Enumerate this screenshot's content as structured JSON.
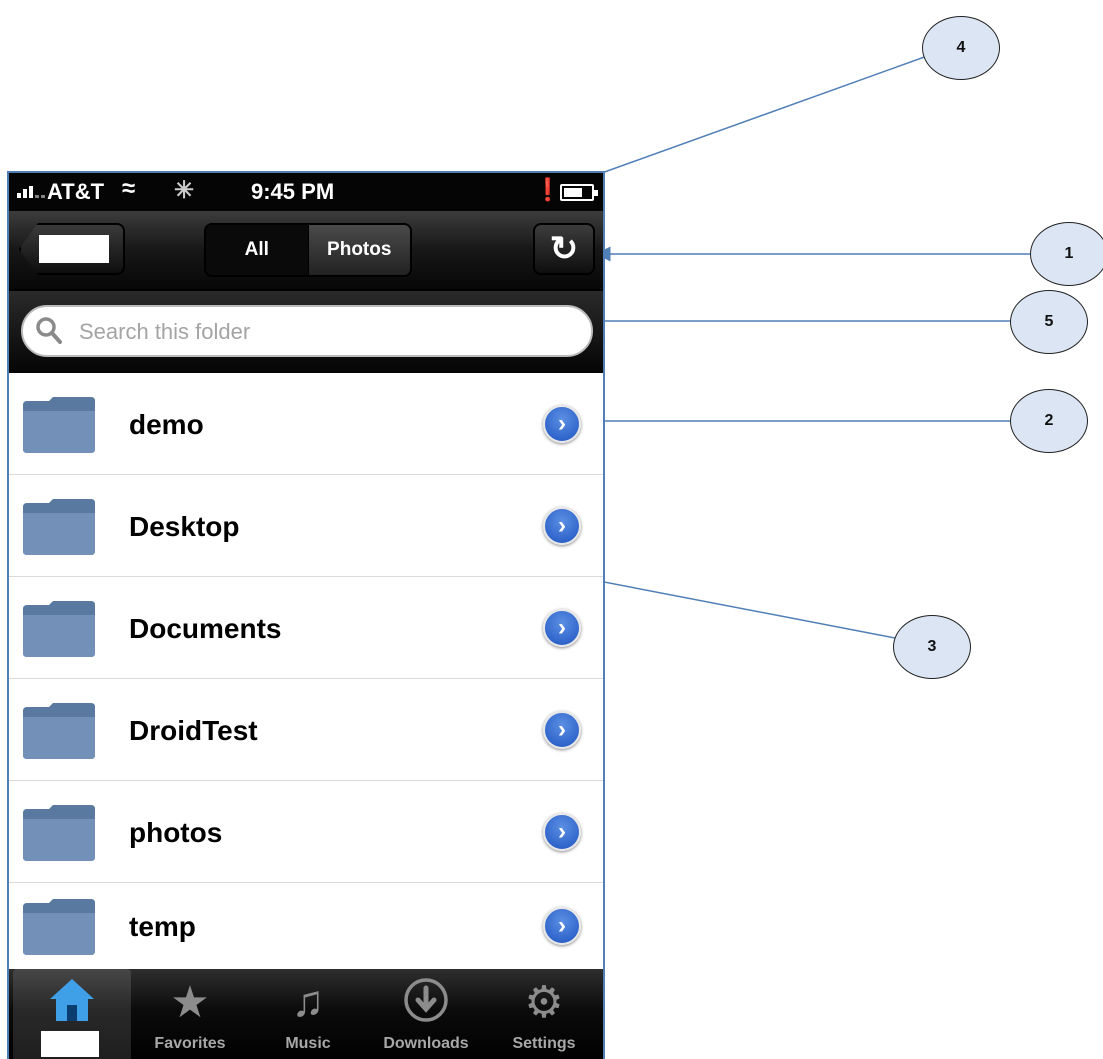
{
  "status_bar": {
    "carrier": "AT&T",
    "time": "9:45 PM"
  },
  "nav_bar": {
    "segments": [
      "All",
      "Photos"
    ],
    "selected_segment": "Photos",
    "refresh_glyph": "↻"
  },
  "search": {
    "placeholder": "Search this folder"
  },
  "folders": [
    {
      "name": "demo"
    },
    {
      "name": "Desktop"
    },
    {
      "name": "Documents"
    },
    {
      "name": "DroidTest"
    },
    {
      "name": "photos"
    },
    {
      "name": "temp"
    }
  ],
  "tab_bar": {
    "tabs": [
      {
        "label": "",
        "icon": "home-icon"
      },
      {
        "label": "Favorites",
        "icon": "star-icon"
      },
      {
        "label": "Music",
        "icon": "music-note-icon"
      },
      {
        "label": "Downloads",
        "icon": "download-icon"
      },
      {
        "label": "Settings",
        "icon": "gear-icon"
      }
    ]
  },
  "callouts": [
    "1",
    "2",
    "3",
    "4",
    "5"
  ],
  "colors": {
    "accent_blue": "#2a62c9",
    "callout_fill": "#dbe5f3",
    "callout_line": "#4f7fb6"
  }
}
